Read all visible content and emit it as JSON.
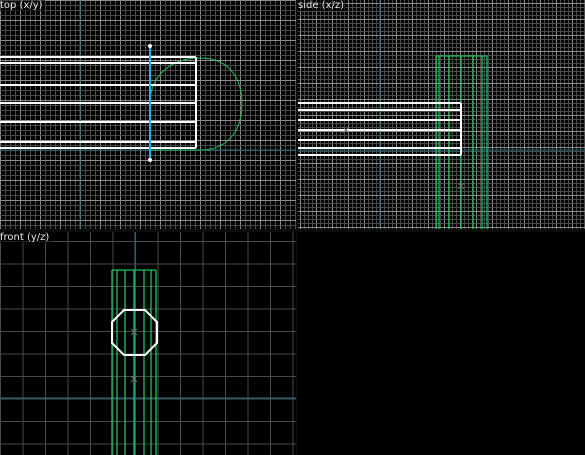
{
  "viewports": {
    "top": {
      "label": "top (x/y)"
    },
    "side": {
      "label": "side (x/z)"
    },
    "front": {
      "label": "front (y/z)"
    },
    "perspective": {
      "label": ""
    }
  },
  "colors": {
    "background": "#000000",
    "grid_minor": "#4a4a4a",
    "grid_major": "#8c8c8c",
    "axis": "#1f6d80",
    "brush_selected": "#ffffff",
    "brush_other": "#1fc25a",
    "camera": "#19b8e6",
    "origin_marker": "#707070"
  },
  "icons": {
    "camera": "camera-marker-icon",
    "origin": "origin-cross-icon"
  }
}
